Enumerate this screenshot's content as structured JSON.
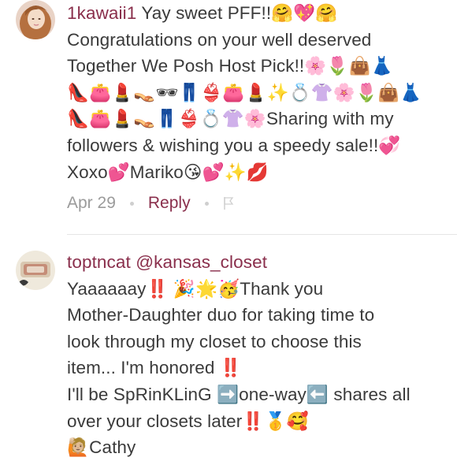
{
  "comments": [
    {
      "username": "1kawaii1",
      "lines": [
        "Yay sweet PFF!!🤗💖🤗",
        "Congratulations on your well deserved",
        "Together We Posh Host Pick!!🌸🌷👜👗",
        "👠👛💄👡🕶👖👙👛💄✨💍👚🌸🌷👜👗",
        "👠👛💄👡👖👙💍👚🌸Sharing with my",
        "followers & wishing you a speedy sale!!💞",
        "Xoxo💕Mariko😘💕✨💋"
      ],
      "date": "Apr 29",
      "reply_label": "Reply"
    },
    {
      "username": "toptncat",
      "mention": "@kansas_closet",
      "lines": [
        "Yaaaaaay‼️ 🎉🌟🥳Thank you",
        "Mother-Daughter duo for taking time to",
        "look through my closet to choose this",
        "item... I'm honored ‼️",
        "I'll be SpRinKLinG ➡️one-way⬅️ shares all",
        "over your closets later‼️🥇🥰",
        "🙋🏼Cathy"
      ]
    }
  ],
  "colors": {
    "username": "#8a2f4c",
    "text": "#3a3a3a",
    "meta": "#9b9b9b"
  }
}
